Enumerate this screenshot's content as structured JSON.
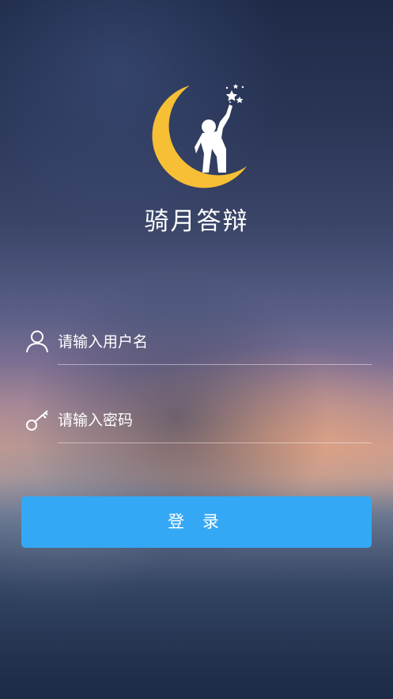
{
  "app": {
    "title": "骑月答辩"
  },
  "login_form": {
    "username": {
      "placeholder": "请输入用户名",
      "icon": "user-icon"
    },
    "password": {
      "placeholder": "请输入密码",
      "icon": "key-icon"
    },
    "submit_label": "登 录"
  },
  "colors": {
    "accent": "#34a8f5",
    "moon": "#f6bf35",
    "text": "#ffffff"
  }
}
